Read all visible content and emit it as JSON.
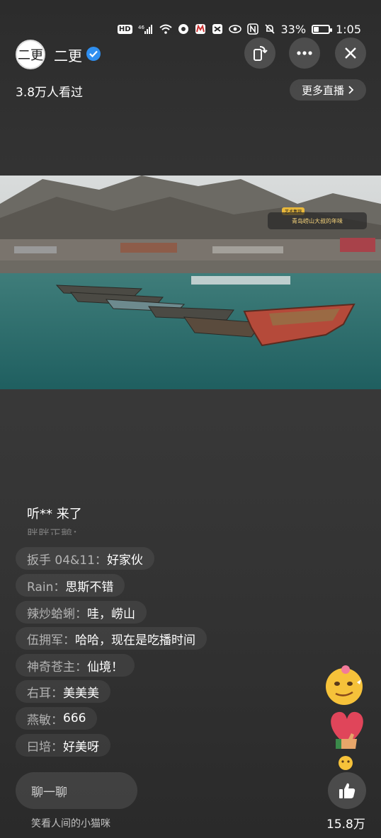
{
  "status_bar": {
    "hd": "HD",
    "network": "46",
    "battery_percent": "33%",
    "battery_level": 0.33,
    "time": "1:05"
  },
  "header": {
    "avatar_text": "二更",
    "host_name": "二更",
    "viewers": "3.8万人看过",
    "more_live": "更多直播"
  },
  "video": {
    "caption_tag": "艺术集锦",
    "caption": "青岛崂山大叔的年味"
  },
  "chat": {
    "join_notice": "听** 来了",
    "faded_line": "胖胖正鹅：",
    "messages": [
      {
        "user": "扳手 04&11：",
        "text": "好家伙"
      },
      {
        "user": "Rain：",
        "text": "思斯不错"
      },
      {
        "user": "辣炒蛤蜊：",
        "text": "哇，崂山"
      },
      {
        "user": "伍拥军：",
        "text": "哈哈，现在是吃播时间"
      },
      {
        "user": "神奇苍主：",
        "text": "仙境！"
      },
      {
        "user": "右耳：",
        "text": "美美美"
      },
      {
        "user": "燕敏：",
        "text": "666"
      },
      {
        "user": "曰培：",
        "text": "好美呀"
      }
    ]
  },
  "bottom": {
    "input_placeholder": "聊一聊",
    "username": "笑看人间的小猫咪",
    "like_count": "15.8万"
  },
  "colors": {
    "verified": "#2f8ff0",
    "background": "#333333"
  }
}
